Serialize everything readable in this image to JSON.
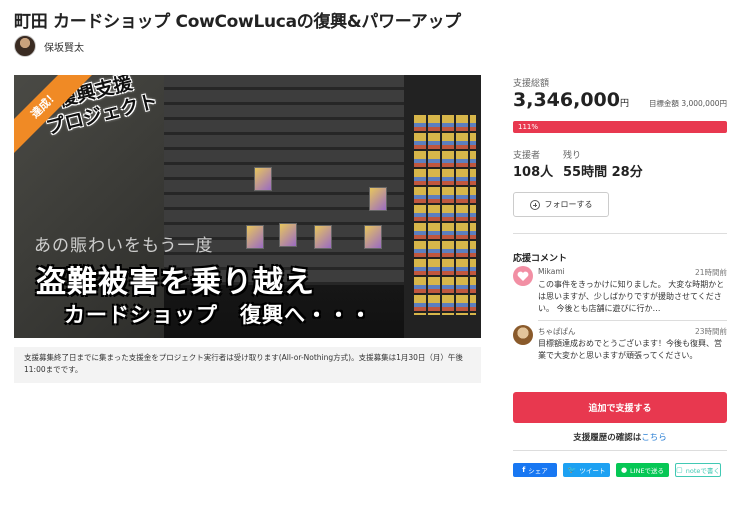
{
  "header": {
    "title": "町田 カードショップ CowCowLucaの復興&パワーアップ",
    "author_name": "保坂賢太"
  },
  "hero": {
    "badge": "達成！",
    "stamp_line1": "復興支援",
    "stamp_line2": "プロジェクト",
    "sub_text": "あの賑わいをもう一度",
    "main_text": "盗難被害を乗り越え",
    "shop_text": "カードショップ　復興へ・・・"
  },
  "notice": "支援募集終了日までに集まった支援金をプロジェクト実行者は受け取ります(All-or-Nothing方式)。支援募集は1月30日（月）午後11:00までです。",
  "funding": {
    "total_label": "支援総額",
    "total_amount": "3,346,000",
    "yen": "円",
    "goal_text": "目標金額 3,000,000円",
    "progress_text": "111%",
    "progress_percent": 111,
    "supporters_label": "支援者",
    "supporters_value": "108人",
    "remaining_label": "残り",
    "remaining_value": "55時間 28分",
    "follow_label": "フォローする"
  },
  "comments": {
    "title": "応援コメント",
    "items": [
      {
        "name": "Mikami",
        "time": "21時間前",
        "body": "この事件をきっかけに知りました。 大変な時期かとは思いますが、少しばかりですが援助させてください。 今後とも店舗に遊びに行か…",
        "avatar_color": "#f28fa4"
      },
      {
        "name": "ちゃぱぱん",
        "time": "23時間前",
        "body": "目標額達成おめでとうございます！今後も復興、営業で大変かと思いますが頑張ってください。",
        "avatar_color": "#b07a3e"
      }
    ]
  },
  "actions": {
    "back_button": "追加で支援する",
    "history_text": "支援履歴の確認は",
    "history_link": "こちら"
  },
  "share": {
    "facebook": "シェア",
    "twitter": "ツイート",
    "line": "LINEで送る",
    "note": "noteで書く"
  },
  "colors": {
    "accent": "#e8384f",
    "badge": "#f08a25",
    "link": "#2a7fd4"
  }
}
